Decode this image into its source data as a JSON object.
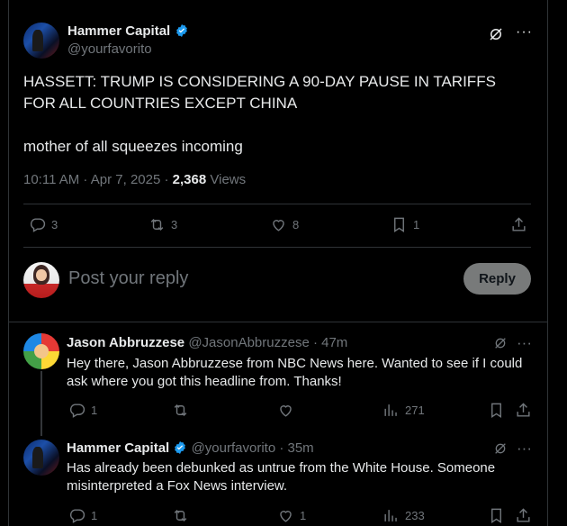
{
  "main_post": {
    "author_name": "Hammer Capital",
    "handle": "@yourfavorito",
    "headline": "HASSETT: TRUMP IS CONSIDERING A 90-DAY PAUSE IN TARIFFS FOR ALL COUNTRIES EXCEPT CHINA",
    "line2": "mother of all squeezes incoming",
    "timestamp": "10:11 AM · Apr 7, 2025",
    "separator": " · ",
    "views_count": "2,368",
    "views_label": " Views",
    "replies": "3",
    "reposts": "3",
    "likes": "8",
    "bookmarks": "1"
  },
  "composer": {
    "placeholder": "Post your reply",
    "reply_label": "Reply"
  },
  "replies": [
    {
      "author_name": "Jason Abbruzzese",
      "handle_time": "@JasonAbbruzzese · 47m",
      "text": "Hey there, Jason Abbruzzese from NBC News here. Wanted to see if I could ask where you got this headline from. Thanks!",
      "replies": "1",
      "likes": "",
      "views": "271"
    },
    {
      "author_name": "Hammer Capital",
      "handle_time": "@yourfavorito · 35m",
      "text": "Has already been debunked as untrue from the White House. Someone misinterpreted a Fox News interview.",
      "replies": "1",
      "likes": "1",
      "views": "233"
    }
  ],
  "icons": [
    "grok-icon",
    "more-icon",
    "reply-icon",
    "repost-icon",
    "like-icon",
    "bookmark-icon",
    "share-icon",
    "views-icon",
    "verified-icon"
  ],
  "colors": {
    "verified": "#1d9bf0",
    "muted": "#71767b",
    "text": "#e7e9ea",
    "background": "#000000",
    "border": "#2f3336"
  }
}
